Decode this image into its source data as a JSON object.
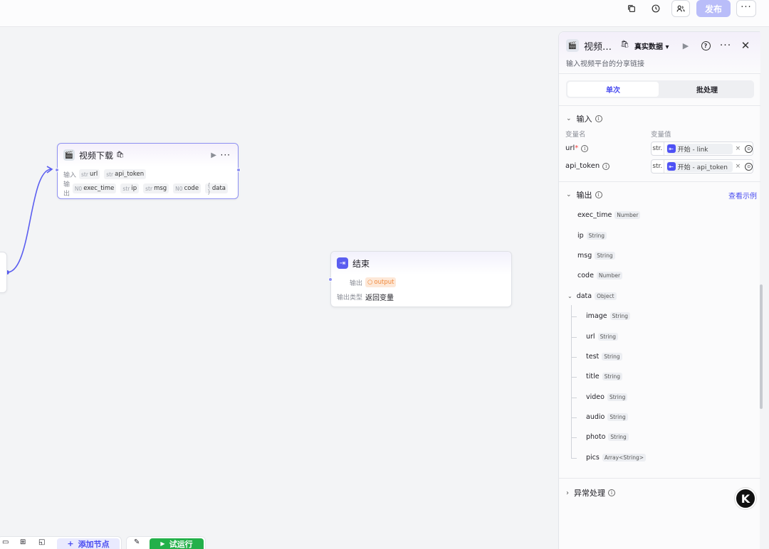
{
  "topbar": {
    "publish_label": "发布",
    "icons": [
      "copy-icon",
      "history-icon",
      "users-icon",
      "more-icon"
    ]
  },
  "canvas": {
    "video_node": {
      "title": "视频下载",
      "input_label": "输入",
      "output_label": "输出",
      "inputs": [
        {
          "type": "str",
          "name": "url"
        },
        {
          "type": "str",
          "name": "api_token"
        }
      ],
      "outputs": [
        {
          "type": "N0",
          "name": "exec_time"
        },
        {
          "type": "str",
          "name": "ip"
        },
        {
          "type": "str",
          "name": "msg"
        },
        {
          "type": "N0",
          "name": "code"
        },
        {
          "type": "{ }",
          "name": "data"
        }
      ]
    },
    "end_node": {
      "title": "结束",
      "output_label": "输出",
      "output_value": "output",
      "output_type_label": "输出类型",
      "output_type_value": "返回变量"
    }
  },
  "bottombar": {
    "add_node_label": "添加节点",
    "run_label": "试运行"
  },
  "panel": {
    "title": "视频…",
    "data_mode": "真实数据",
    "subtitle": "输入视频平台的分享链接",
    "tabs": [
      {
        "label": "单次",
        "active": true
      },
      {
        "label": "批处理",
        "active": false
      }
    ],
    "input_section": {
      "title": "输入",
      "col_name": "变量名",
      "col_value": "变量值",
      "rows": [
        {
          "name": "url",
          "required": true,
          "type": "str.",
          "ref": "开始 - link"
        },
        {
          "name": "api_token",
          "required": false,
          "type": "str.",
          "ref": "开始 - api_token"
        }
      ]
    },
    "output_section": {
      "title": "输出",
      "view_example": "查看示例",
      "items": [
        {
          "name": "exec_time",
          "type": "Number"
        },
        {
          "name": "ip",
          "type": "String"
        },
        {
          "name": "msg",
          "type": "String"
        },
        {
          "name": "code",
          "type": "Number"
        },
        {
          "name": "data",
          "type": "Object"
        }
      ],
      "data_children": [
        {
          "name": "image",
          "type": "String"
        },
        {
          "name": "url",
          "type": "String"
        },
        {
          "name": "test",
          "type": "String"
        },
        {
          "name": "title",
          "type": "String"
        },
        {
          "name": "video",
          "type": "String"
        },
        {
          "name": "audio",
          "type": "String"
        },
        {
          "name": "photo",
          "type": "String"
        },
        {
          "name": "pics",
          "type": "Array<String>"
        }
      ]
    },
    "error_section": {
      "title": "异常处理"
    }
  },
  "badge": {
    "letter": "K"
  },
  "colors": {
    "accent": "#4a4df0",
    "run": "#23b04a",
    "publish": "#b9bdf9"
  }
}
